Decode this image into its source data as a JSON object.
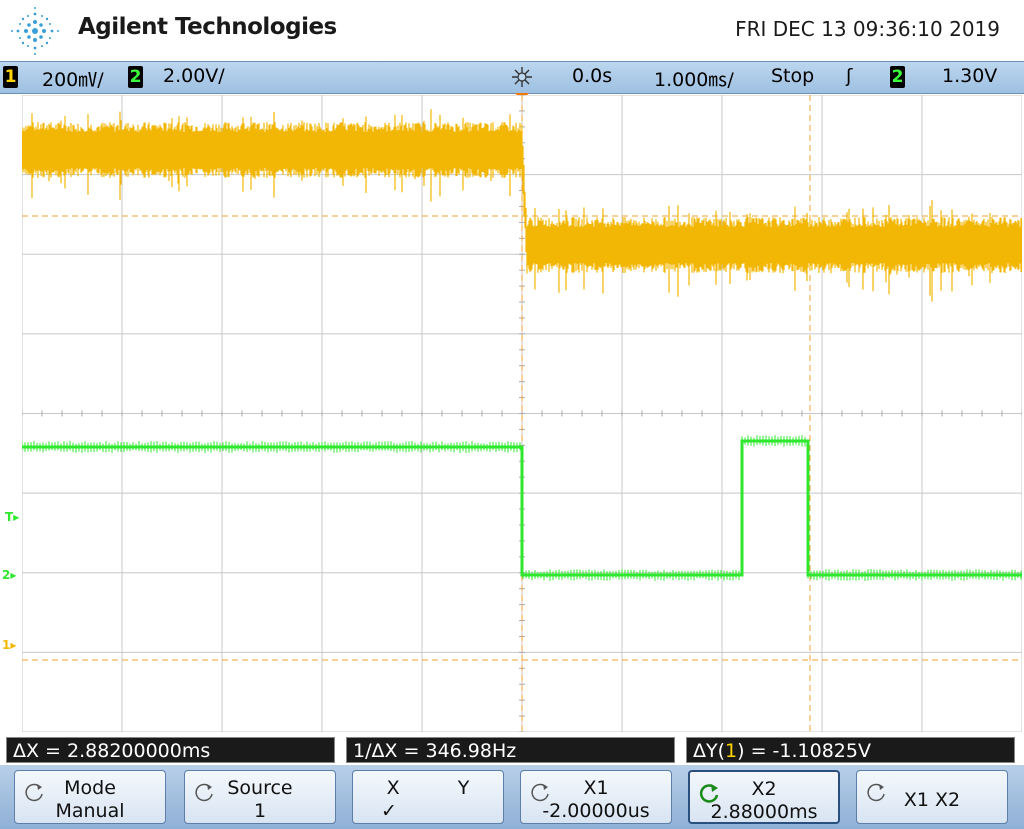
{
  "header": {
    "brand": "Agilent Technologies",
    "datetime": "FRI DEC 13 09:36:10 2019"
  },
  "status": {
    "ch1_num": "1",
    "ch1_scale": "200㎷/",
    "ch2_num": "2",
    "ch2_scale": "2.00V/",
    "time_delay": "0.0s",
    "time_scale": "1.000㎳/",
    "run_state": "Stop",
    "trigger_edge": "ʃ",
    "trigger_source": "2",
    "trigger_level": "1.30V"
  },
  "markers": {
    "trigger": "T",
    "ch2": "2",
    "ch1": "1"
  },
  "measurements": {
    "delta_x": "ΔX = 2.88200000ms",
    "inv_delta_x": "1/ΔX = 346.98Hz",
    "delta_y_prefix": "ΔY(",
    "delta_y_ch": "1",
    "delta_y_suffix": ") = -1.10825V"
  },
  "softkeys": [
    {
      "line1": "Mode",
      "line2": "Manual"
    },
    {
      "line1": "Source",
      "line2": "1"
    },
    {
      "line1": "X",
      "line1b": "Y",
      "line2": "✓"
    },
    {
      "line1": "X1",
      "line2": "-2.00000us"
    },
    {
      "line1": "X2",
      "line2": "2.88000ms"
    },
    {
      "line1": "X1 X2",
      "line2": ""
    }
  ],
  "colors": {
    "ch1": "#f2b705",
    "ch2": "#2ee82e",
    "cursor": "#f0a030",
    "grid": "#c8c8c8"
  }
}
